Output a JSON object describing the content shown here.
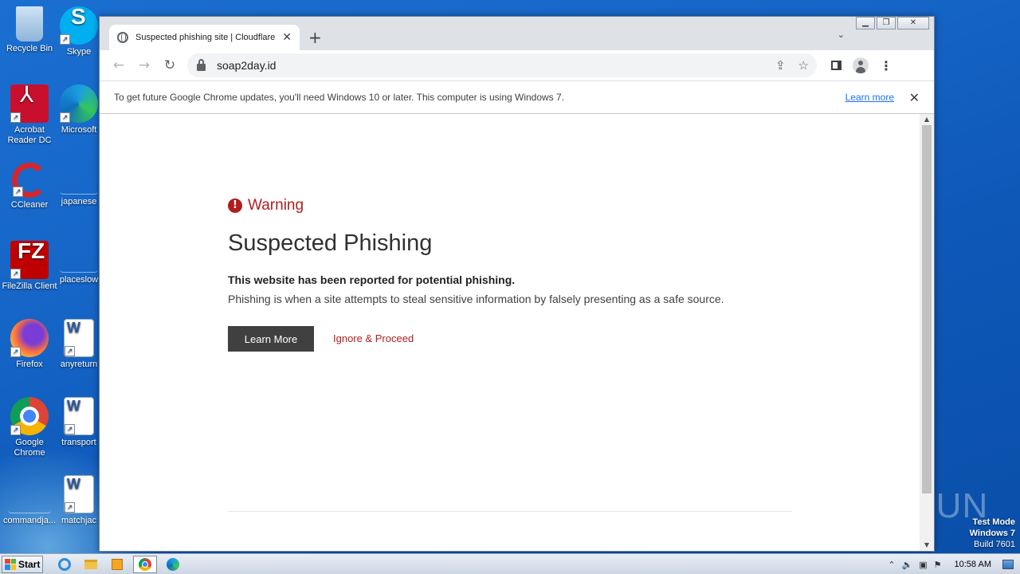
{
  "desktop": {
    "icons": [
      {
        "label": "Recycle Bin",
        "icon": "recycle-bin-icon"
      },
      {
        "label": "Skype",
        "icon": "skype-icon"
      },
      {
        "label": "Acrobat Reader DC",
        "icon": "acrobat-icon"
      },
      {
        "label": "Microsoft",
        "icon": "edge-icon"
      },
      {
        "label": "CCleaner",
        "icon": "ccleaner-icon"
      },
      {
        "label": "japanese",
        "icon": "file-icon"
      },
      {
        "label": "FileZilla Client",
        "icon": "filezilla-icon"
      },
      {
        "label": "placeslow",
        "icon": "file-icon"
      },
      {
        "label": "Firefox",
        "icon": "firefox-icon"
      },
      {
        "label": "anyreturn",
        "icon": "word-doc-icon"
      },
      {
        "label": "Google Chrome",
        "icon": "chrome-icon"
      },
      {
        "label": "transport",
        "icon": "word-doc-icon"
      },
      {
        "label": "commandja...",
        "icon": "file-icon"
      },
      {
        "label": "matchjac",
        "icon": "word-doc-icon"
      }
    ],
    "watermark": "ANY RUN",
    "test_mode": [
      "Test Mode",
      "Windows 7",
      "Build 7601"
    ]
  },
  "browser": {
    "tab_title": "Suspected phishing site | Cloudflare",
    "tab_close": "✕",
    "new_tab": "+",
    "tab_search": "⌄",
    "url": "soap2day.id",
    "infobar": {
      "text": "To get future Google Chrome updates, you'll need Windows 10 or later. This computer is using Windows 7.",
      "link": "Learn more",
      "close": "✕"
    }
  },
  "page": {
    "warning_label": "Warning",
    "warning_symbol": "!",
    "title": "Suspected Phishing",
    "bold_line": "This website has been reported for potential phishing.",
    "description": "Phishing is when a site attempts to steal sensitive information by falsely presenting as a safe source.",
    "learn_more_button": "Learn More",
    "ignore_link": "Ignore & Proceed",
    "accent_color": "#b01e1e",
    "button_color": "#404040"
  },
  "taskbar": {
    "start_label": "Start",
    "clock": "10:58 AM"
  }
}
